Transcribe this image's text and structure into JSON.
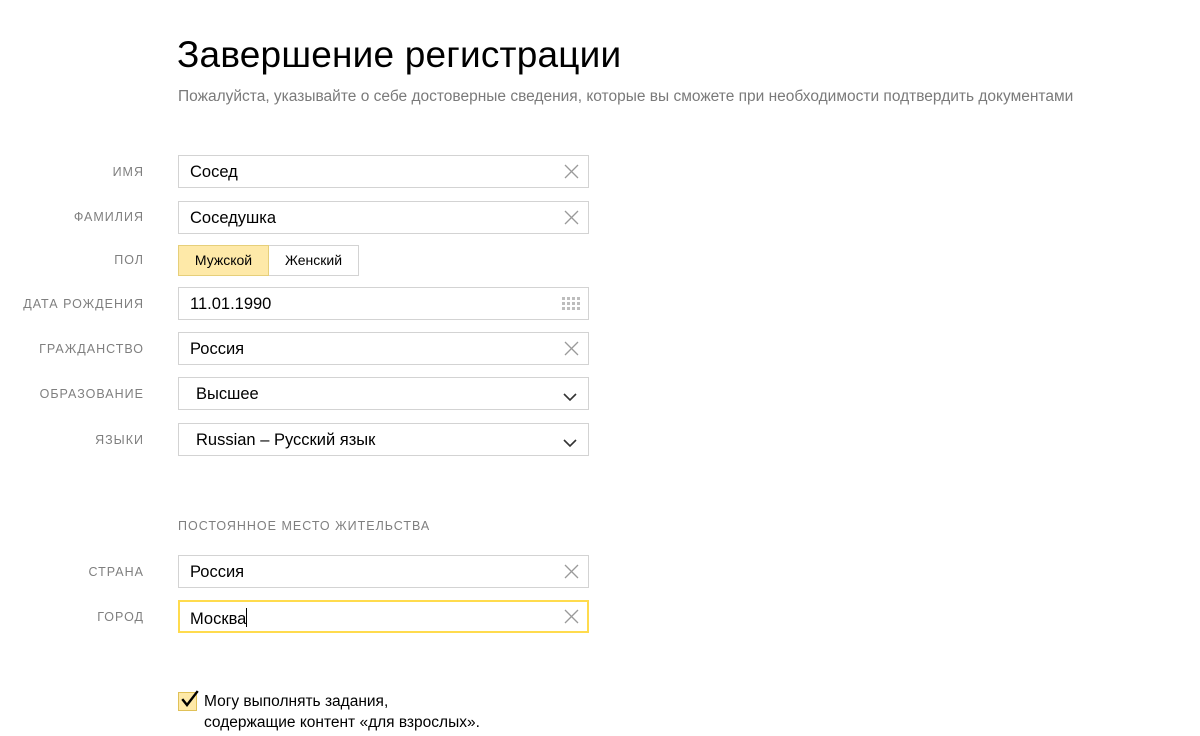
{
  "header": {
    "title": "Завершение регистрации",
    "subtitle": "Пожалуйста, указывайте о себе достоверные сведения, которые вы сможете при необходимости подтвердить документами"
  },
  "form": {
    "first_name": {
      "label": "Имя",
      "value": "Сосед"
    },
    "last_name": {
      "label": "Фамилия",
      "value": "Соседушка"
    },
    "gender": {
      "label": "Пол",
      "options": [
        "Мужской",
        "Женский"
      ],
      "selected": "Мужской"
    },
    "birth_date": {
      "label": "Дата рождения",
      "value": "11.01.1990"
    },
    "citizenship": {
      "label": "Гражданство",
      "value": "Россия"
    },
    "education": {
      "label": "Образование",
      "value": "Высшее"
    },
    "languages": {
      "label": "Языки",
      "value": "Russian – Русский язык"
    }
  },
  "residence": {
    "section_title": "Постоянное место жительства",
    "country": {
      "label": "Страна",
      "value": "Россия"
    },
    "city": {
      "label": "Город",
      "value": "Москва"
    }
  },
  "adult_content": {
    "checked": true,
    "line1": "Могу выполнять задания,",
    "line2": "содержащие контент «для взрослых»."
  },
  "icons": {
    "clear": "close-icon",
    "dropdown": "chevron-down-icon",
    "calendar": "calendar-icon",
    "check": "checkmark-icon"
  },
  "colors": {
    "accent_yellow": "#fee9a8",
    "focus_border": "#ffdb4d",
    "label_gray": "#7f7f7f",
    "border_gray": "#d3d3d3"
  }
}
